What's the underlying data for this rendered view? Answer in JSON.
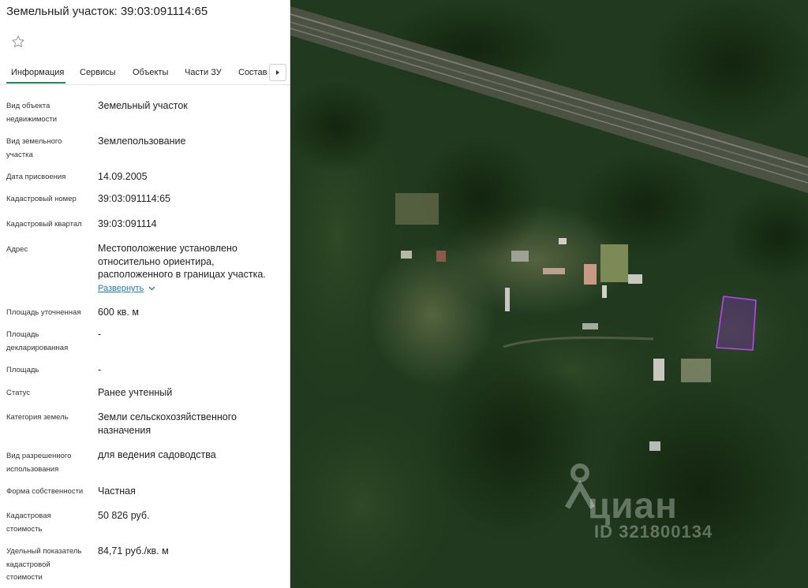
{
  "title": "Земельный участок: 39:03:091114:65",
  "favorite_icon": "star-outline-icon",
  "tabs": [
    {
      "label": "Информация",
      "active": true
    },
    {
      "label": "Сервисы",
      "active": false
    },
    {
      "label": "Объекты",
      "active": false
    },
    {
      "label": "Части ЗУ",
      "active": false
    },
    {
      "label": "Состав",
      "active": false
    }
  ],
  "tabs_next_icon": "chevron-right-icon",
  "fields": [
    {
      "label": "Вид объекта недвижимости",
      "value": "Земельный участок"
    },
    {
      "label": "Вид земельного участка",
      "value": "Землепользование"
    },
    {
      "label": "Дата присвоения",
      "value": "14.09.2005"
    },
    {
      "label": "Кадастровый номер",
      "value": "39:03:091114:65"
    },
    {
      "label": "Кадастровый квартал",
      "value": "39:03:091114"
    },
    {
      "label": "Адрес",
      "value": "Местоположение установлено относительно ориентира, расположенного в границах участка."
    },
    {
      "label": "Площадь уточненная",
      "value": "600 кв. м"
    },
    {
      "label": "Площадь декларированная",
      "value": "-"
    },
    {
      "label": "Площадь",
      "value": "-"
    },
    {
      "label": "Статус",
      "value": "Ранее учтенный"
    },
    {
      "label": "Категория земель",
      "value": "Земли сельскохозяйственного назначения"
    },
    {
      "label": "Вид разрешенного использования",
      "value": "для ведения садоводства"
    },
    {
      "label": "Форма собственности",
      "value": "Частная"
    },
    {
      "label": "Кадастровая стоимость",
      "value": "50 826 руб."
    },
    {
      "label": "Удельный показатель кадастровой стоимости",
      "value": "84,71 руб./кв. м"
    }
  ],
  "address_expand": "Развернуть",
  "watermark": {
    "brand": "циан",
    "id": "ID 321800134"
  },
  "colors": {
    "accent": "#1a8b56",
    "link": "#1a7fb5",
    "parcel": "#9b30d9"
  }
}
